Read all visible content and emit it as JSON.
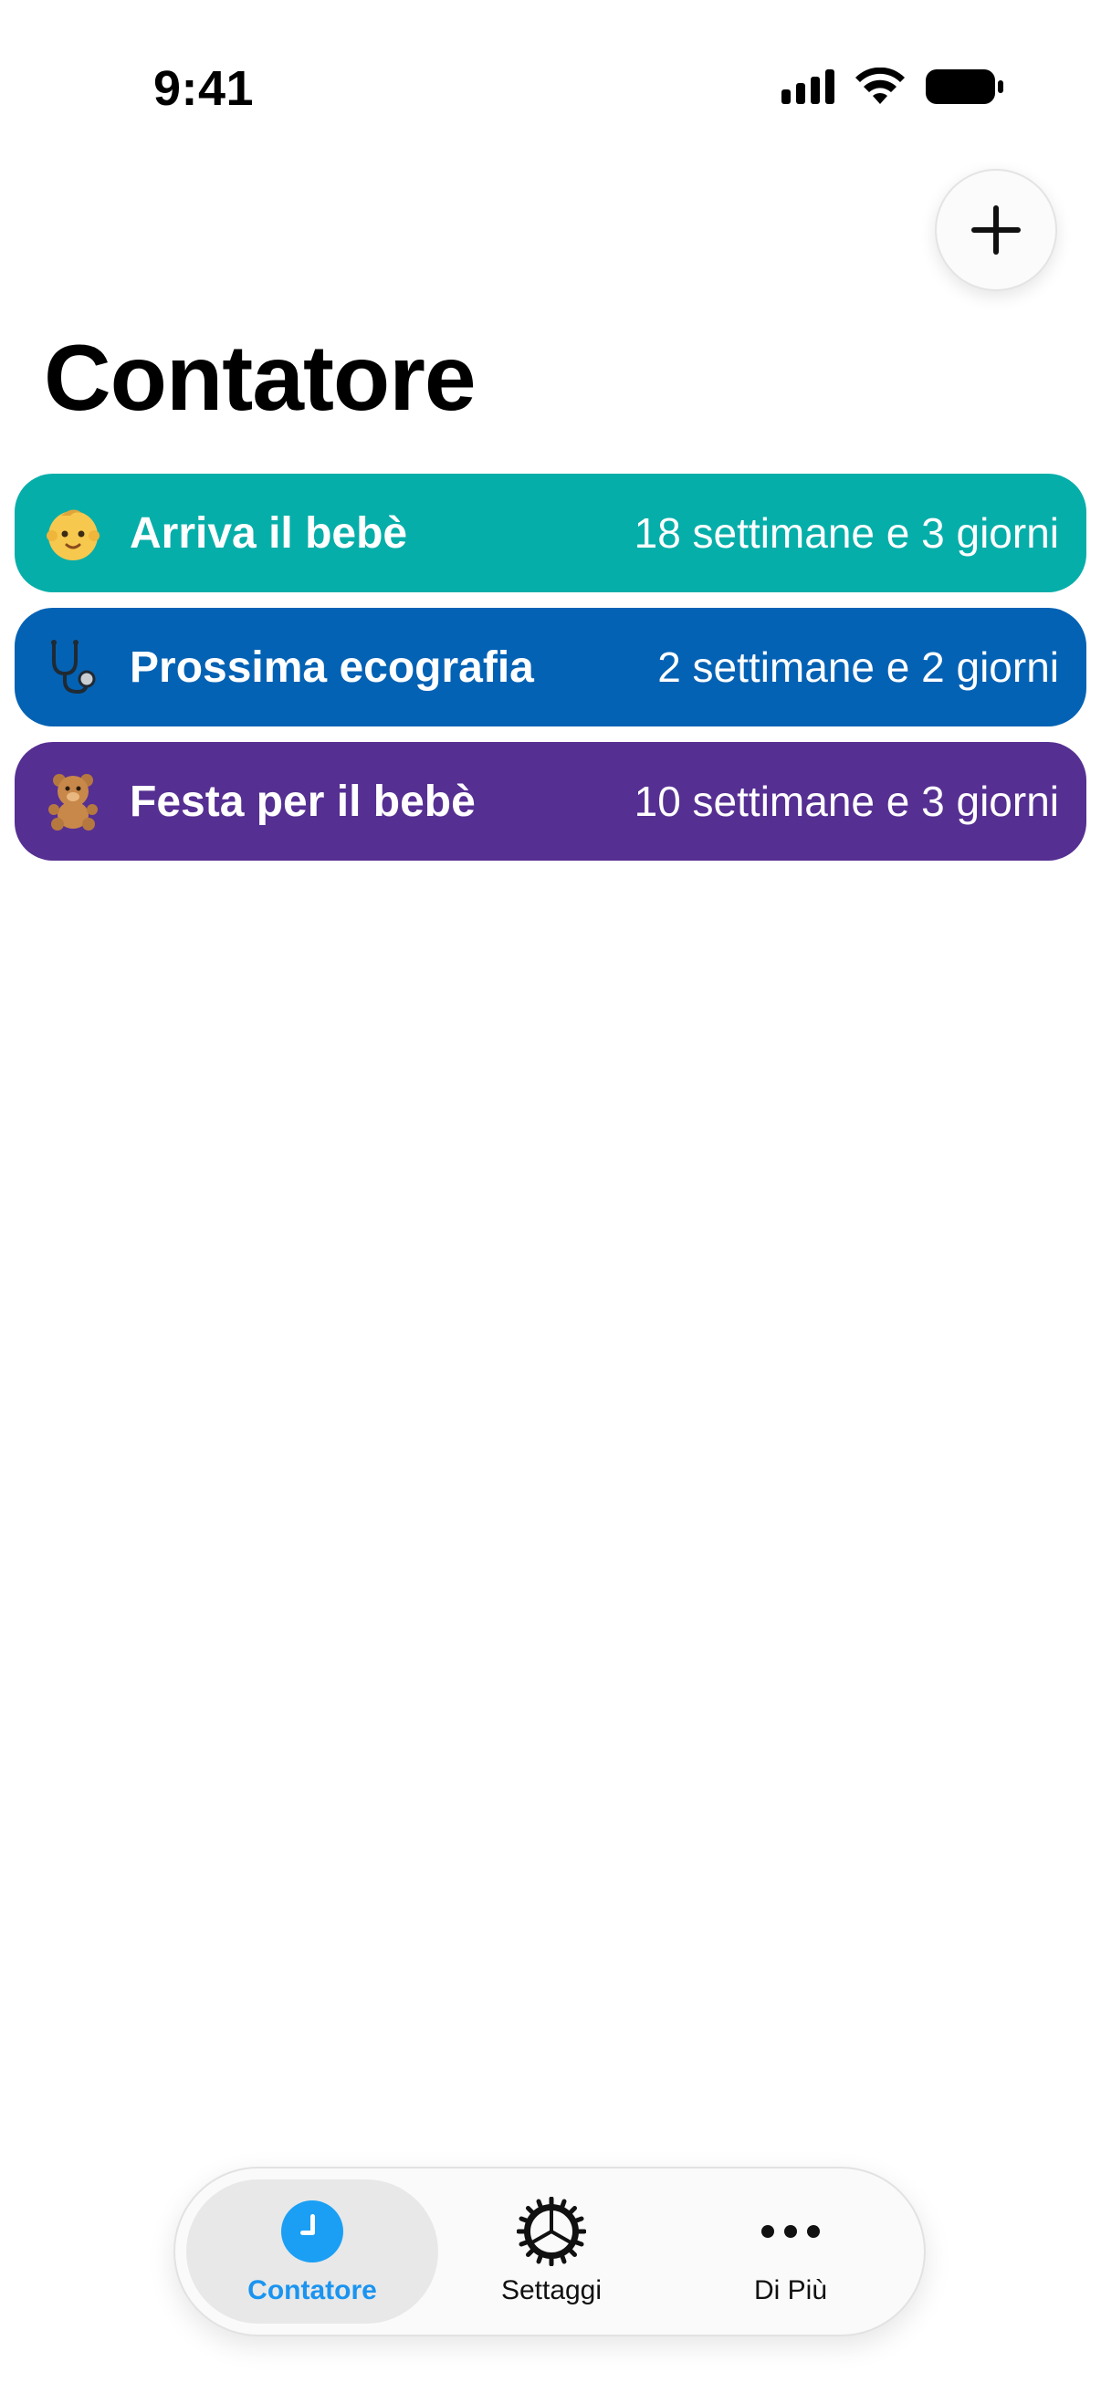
{
  "status_bar": {
    "time": "9:41"
  },
  "header": {
    "title": "Contatore",
    "add_button_icon": "plus-icon"
  },
  "countdowns": [
    {
      "icon": "baby-emoji-icon",
      "title": "Arriva il bebè",
      "value": "18 settimane e 3 giorni",
      "color": "#06AEA9"
    },
    {
      "icon": "stethoscope-icon",
      "title": "Prossima ecografia",
      "value": "2 settimane e 2 giorni",
      "color": "#0462B4"
    },
    {
      "icon": "teddy-bear-icon",
      "title": "Festa per il bebè",
      "value": "10 settimane e 3 giorni",
      "color": "#562F92"
    }
  ],
  "tabbar": {
    "tabs": [
      {
        "label": "Contatore",
        "icon": "clock-icon",
        "active": true
      },
      {
        "label": "Settaggi",
        "icon": "gear-icon",
        "active": false
      },
      {
        "label": "Di Più",
        "icon": "ellipsis-icon",
        "active": false
      }
    ],
    "active_color": "#1A94F0"
  }
}
